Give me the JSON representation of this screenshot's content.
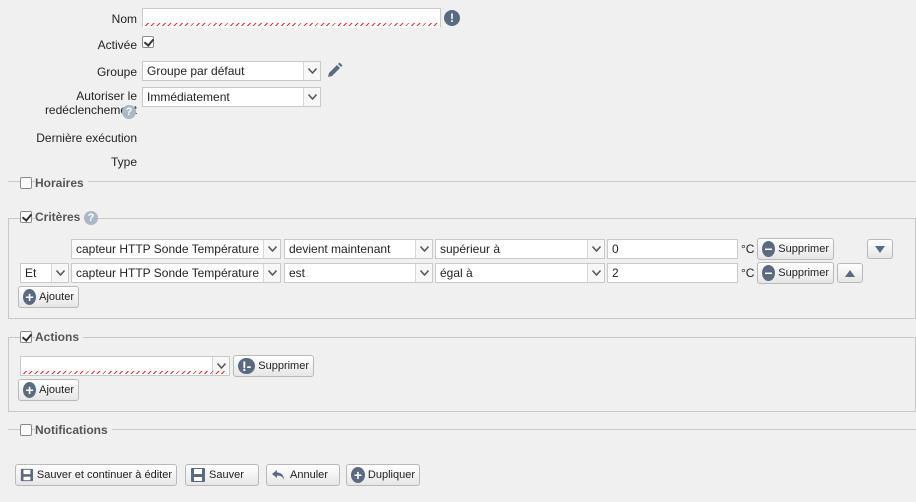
{
  "form": {
    "nom_label": "Nom",
    "nom_value": "",
    "activee_label": "Activée",
    "activee_checked": true,
    "groupe_label": "Groupe",
    "groupe_value": "Groupe par défaut",
    "autoriser_label": "Autoriser le redéclenchement",
    "autoriser_value": "Immédiatement",
    "derniere_label": "Dernière exécution",
    "type_label": "Type"
  },
  "sections": {
    "horaires": {
      "title": "Horaires",
      "checked": false
    },
    "criteres": {
      "title": "Critères",
      "checked": true
    },
    "actions": {
      "title": "Actions",
      "checked": true
    },
    "notifications": {
      "title": "Notifications",
      "checked": false
    }
  },
  "criteria": [
    {
      "connector": "",
      "sensor": "capteur HTTP Sonde Température",
      "event": "devient maintenant",
      "operator": "supérieur à",
      "value": "0",
      "unit": "°C",
      "delete_label": "Supprimer",
      "move": "down"
    },
    {
      "connector": "Et",
      "sensor": "capteur HTTP Sonde Température",
      "event": "est",
      "operator": "égal à",
      "value": "2",
      "unit": "°C",
      "delete_label": "Supprimer",
      "move": "up"
    }
  ],
  "criteria_add_label": "Ajouter",
  "action": {
    "value": "",
    "delete_label": "Supprimer",
    "add_label": "Ajouter"
  },
  "footer": {
    "save_continue": "Sauver et continuer à éditer",
    "save": "Sauver",
    "cancel": "Annuler",
    "duplicate": "Dupliquer"
  },
  "icons": [
    "warning-icon",
    "edit-pencil-icon",
    "help-icon",
    "chevron-down-icon",
    "minus-circle-icon",
    "plus-circle-icon",
    "arrow-up-icon",
    "arrow-down-icon",
    "save-icon",
    "undo-icon",
    "duplicate-icon"
  ],
  "colors": {
    "background": "#f0f0f0",
    "icon": "#5a6a80",
    "help": "#a9b7c6",
    "spell_error": "#e03030"
  }
}
